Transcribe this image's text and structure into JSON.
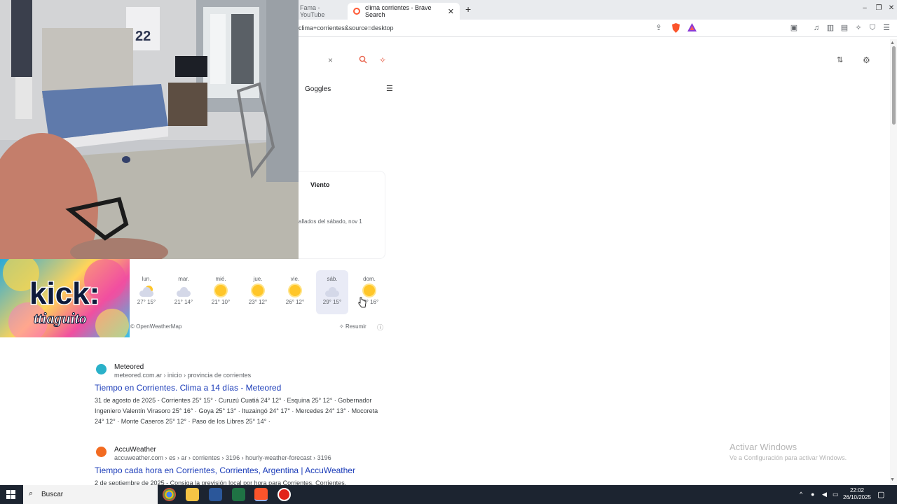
{
  "browser": {
    "tabs": [
      {
        "label": "Fama - YouTube",
        "active": false
      },
      {
        "label": "clima corrientes - Brave Search",
        "active": true
      }
    ],
    "new_tab": "+",
    "url": "clima+corrientes&source=desktop",
    "window_controls": [
      "–",
      "❐",
      "✕"
    ]
  },
  "search": {
    "clear": "×",
    "goggles_label": "Goggles"
  },
  "weather": {
    "wind_label": "Viento",
    "detail_text": "...lados del sábado, nov 1",
    "detail_text_visible": "allados del sábado, nov 1",
    "forecast": [
      {
        "day": "lun.",
        "icon": "partly-cloudy-icon",
        "temps": "27° 15°"
      },
      {
        "day": "mar.",
        "icon": "cloud-icon",
        "temps": "21° 14°"
      },
      {
        "day": "mié.",
        "icon": "sun-icon",
        "temps": "21° 10°"
      },
      {
        "day": "jue.",
        "icon": "sun-icon",
        "temps": "23° 12°"
      },
      {
        "day": "vie.",
        "icon": "sun-icon",
        "temps": "26° 12°"
      },
      {
        "day": "sáb.",
        "icon": "cloud-icon",
        "temps": "29° 15°",
        "selected": true
      },
      {
        "day": "dom.",
        "icon": "sun-icon",
        "temps": "29° 16°"
      }
    ],
    "source": "OpenWeatherMap",
    "summarize": "Resumir"
  },
  "results": [
    {
      "site": "Meteored",
      "url": "meteored.com.ar › inicio › provincia de corrientes",
      "title": "Tiempo en Corrientes. Clima a 14 días - Meteored",
      "snippet": "31 de agosto de 2025 - Corrientes 25° 15° · Curuzú Cuatiá 24° 12° · Esquina 25° 12° · Gobernador Ingeniero Valentín Virasoro 25° 16° · Goya 25° 13° · Ituzaingó 24° 17° · Mercedes 24° 13° · Mocoreta 24° 12° · Monte Caseros 25° 12° · Paso de los Libres 25° 14° ·",
      "favicon_color": "#2ab1c9"
    },
    {
      "site": "AccuWeather",
      "url": "accuweather.com › es › ar › corrientes › 3196 › hourly-weather-forecast › 3196",
      "title": "Tiempo cada hora en Corrientes, Corrientes, Argentina | AccuWeather",
      "snippet": "2 de septiembre de 2025 - Consiga la previsión local por hora para Corrientes, Corrientes,",
      "favicon_color": "#f26b21"
    }
  ],
  "watermark": {
    "line1": "Activar Windows",
    "line2": "Ve a Configuración para activar Windows."
  },
  "overlays": {
    "kick_logo_text": "kick:",
    "kick_sub_text": "ttiaguito",
    "jersey_number": "22"
  },
  "taskbar": {
    "search_placeholder": "Buscar",
    "time": "22:02",
    "date": "26/10/2025"
  }
}
